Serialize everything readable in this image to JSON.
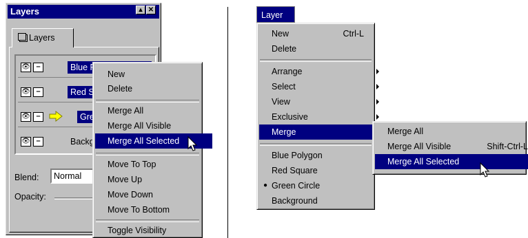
{
  "layers_panel": {
    "title": "Layers",
    "tab_label": "Layers",
    "layers": [
      {
        "name": "Blue Polygon",
        "selected": true,
        "active": false
      },
      {
        "name": "Red Square",
        "selected": true,
        "active": false
      },
      {
        "name": "Green Circle",
        "selected": true,
        "active": true
      },
      {
        "name": "Background",
        "selected": false,
        "active": false
      }
    ],
    "blend_label": "Blend:",
    "blend_value": "Normal",
    "opacity_label": "Opacity:"
  },
  "context_menu": {
    "items": [
      "New",
      "Delete",
      "Merge All",
      "Merge All Visible",
      "Merge All Selected",
      "Move To Top",
      "Move Up",
      "Move Down",
      "Move To Bottom",
      "Toggle Visibility"
    ]
  },
  "layer_menu": {
    "title": "Layer",
    "items": [
      {
        "label": "New",
        "shortcut": "Ctrl-L"
      },
      {
        "label": "Delete"
      },
      {
        "label": "Arrange"
      },
      {
        "label": "Select"
      },
      {
        "label": "View"
      },
      {
        "label": "Exclusive"
      },
      {
        "label": "Merge"
      },
      {
        "label": "Blue Polygon"
      },
      {
        "label": "Red Square"
      },
      {
        "label": "Green Circle",
        "checked": true
      },
      {
        "label": "Background"
      }
    ]
  },
  "merge_submenu": {
    "items": [
      {
        "label": "Merge All"
      },
      {
        "label": "Merge All Visible",
        "shortcut": "Shift-Ctrl-L"
      },
      {
        "label": "Merge All Selected"
      }
    ]
  },
  "colors": {
    "highlight": "#000080",
    "face": "#c0c0c0",
    "active_arrow": "#ffff00"
  }
}
